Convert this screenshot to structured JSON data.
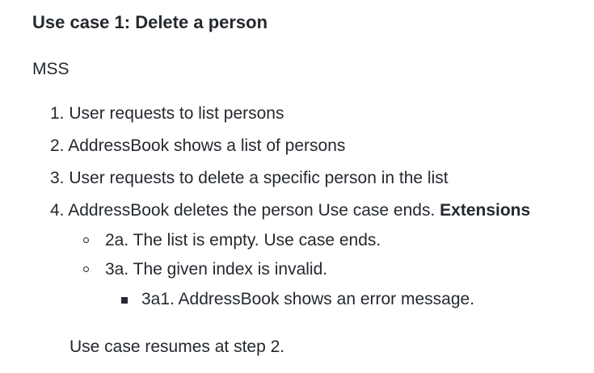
{
  "use_case": {
    "title": "Use case 1: Delete a person",
    "mss_label": "MSS",
    "steps": [
      {
        "number": "1.",
        "text": "User requests to list persons"
      },
      {
        "number": "2.",
        "text": "AddressBook shows a list of persons"
      },
      {
        "number": "3.",
        "text": "User requests to delete a specific person in the list"
      },
      {
        "number": "4.",
        "text": "AddressBook deletes the person Use case ends. ",
        "bold_suffix": "Extensions"
      }
    ],
    "extensions": [
      {
        "text": "2a. The list is empty. Use case ends."
      },
      {
        "text": "3a. The given index is invalid."
      }
    ],
    "sub_extensions": [
      {
        "text": "3a1. AddressBook shows an error message."
      }
    ],
    "resume_text": "Use case resumes at step 2."
  }
}
